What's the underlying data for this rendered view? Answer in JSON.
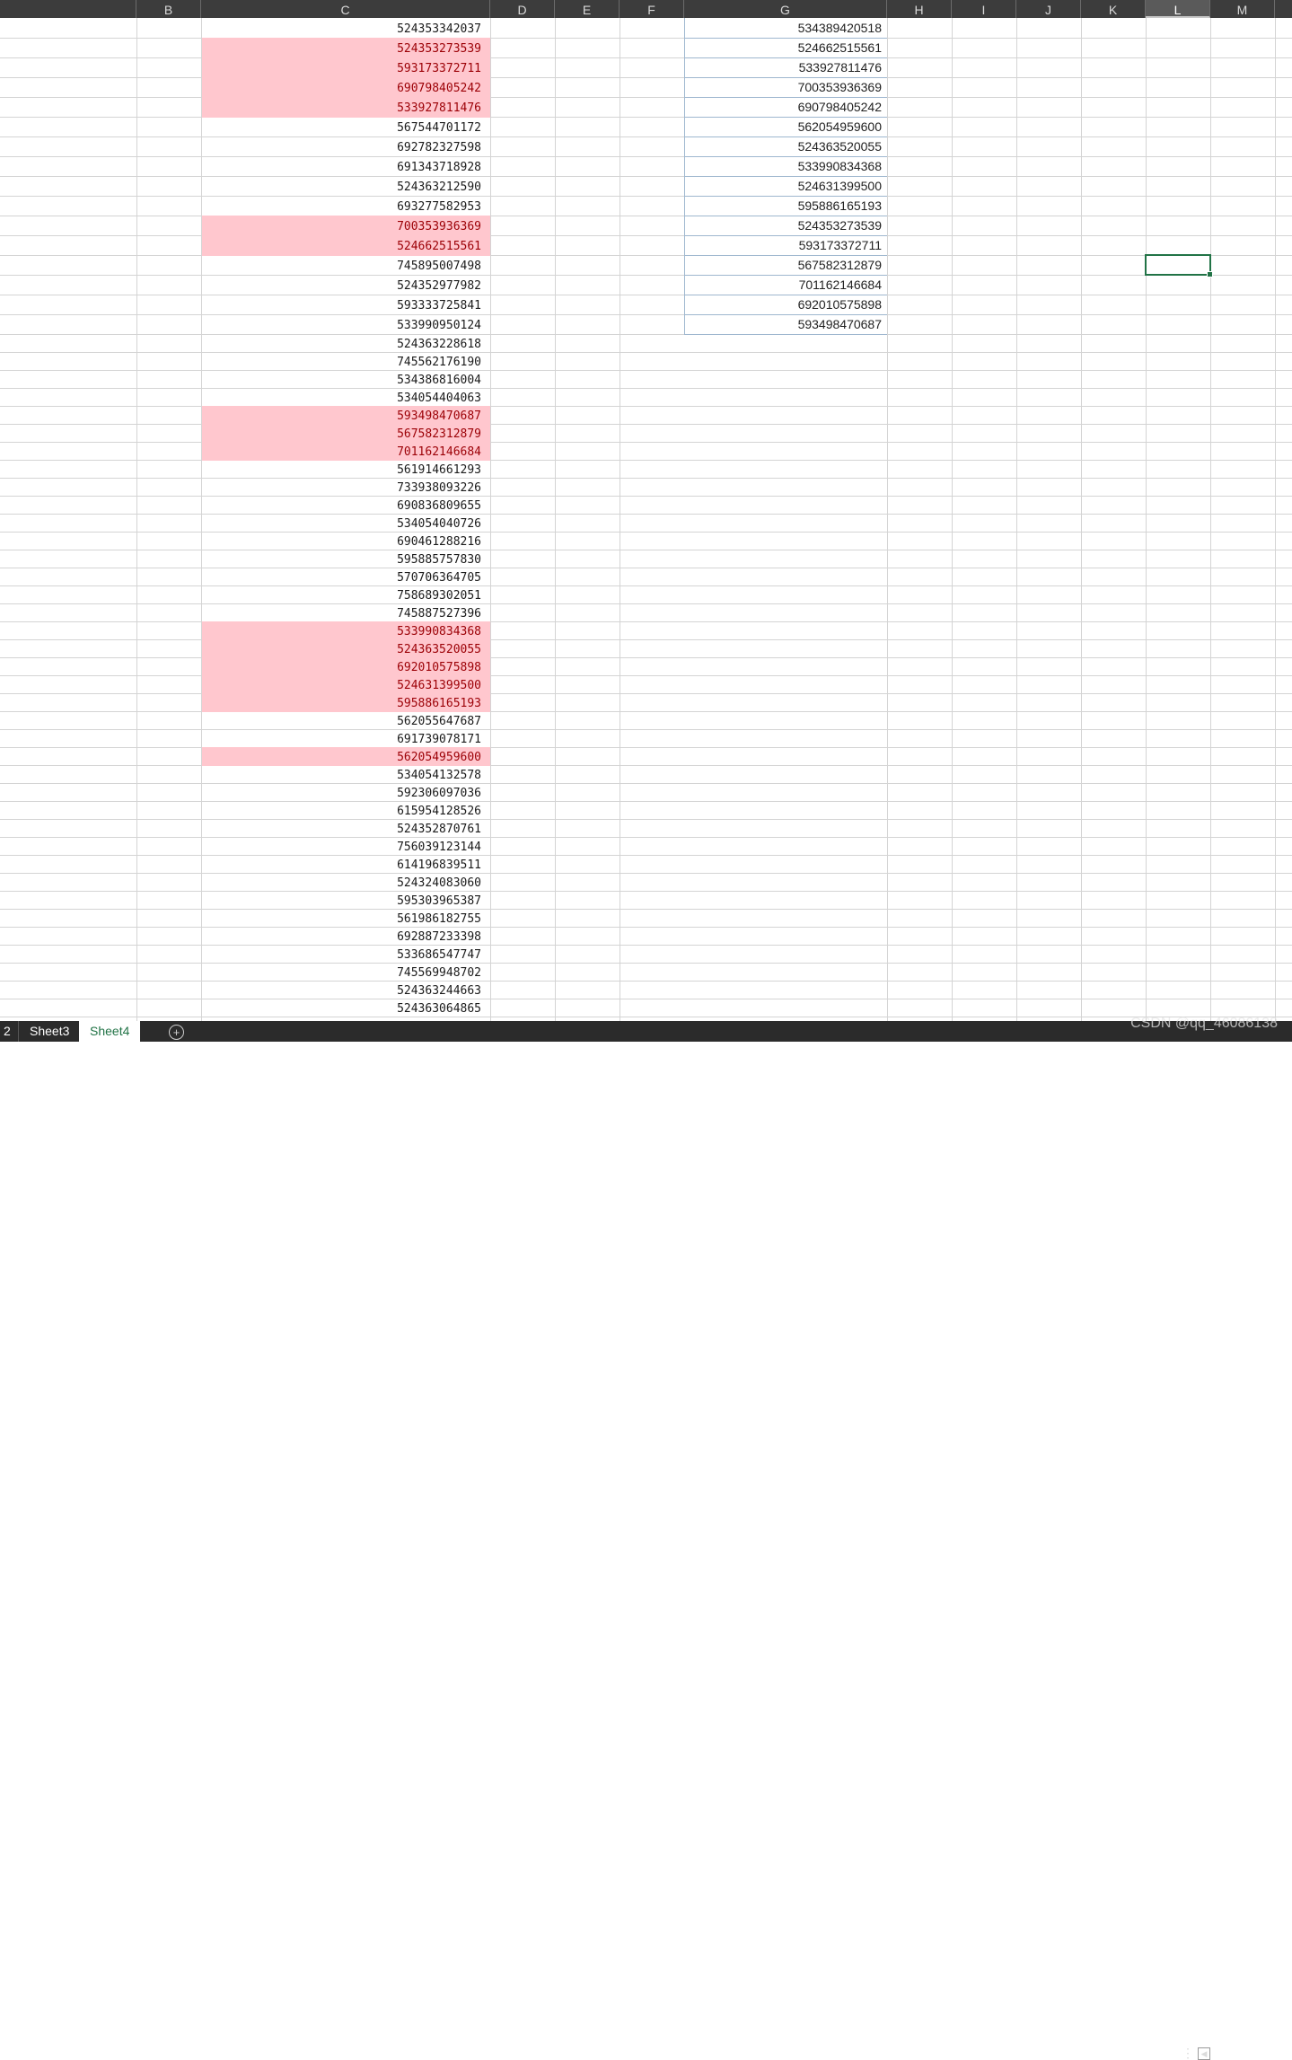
{
  "columns": [
    "B",
    "C",
    "D",
    "E",
    "F",
    "G",
    "H",
    "I",
    "J",
    "K",
    "L",
    "M"
  ],
  "selected_column": "L",
  "column_c_values": [
    "524353342037",
    "524353273539",
    "593173372711",
    "690798405242",
    "533927811476",
    "567544701172",
    "692782327598",
    "691343718928",
    "524363212590",
    "693277582953",
    "700353936369",
    "524662515561",
    "745895007498",
    "524352977982",
    "593333725841",
    "533990950124",
    "524363228618",
    "745562176190",
    "534386816004",
    "534054404063",
    "593498470687",
    "567582312879",
    "701162146684",
    "561914661293",
    "733938093226",
    "690836809655",
    "534054040726",
    "690461288216",
    "595885757830",
    "570706364705",
    "758689302051",
    "745887527396",
    "533990834368",
    "524363520055",
    "692010575898",
    "524631399500",
    "595886165193",
    "562055647687",
    "691739078171",
    "562054959600",
    "534054132578",
    "592306097036",
    "615954128526",
    "524352870761",
    "756039123144",
    "614196839511",
    "524324083060",
    "595303965387",
    "561986182755",
    "692887233398",
    "533686547747",
    "745569948702",
    "524363244663",
    "524363064865"
  ],
  "column_c_highlighted": [
    "524353273539",
    "593173372711",
    "690798405242",
    "533927811476",
    "700353936369",
    "524662515561",
    "593498470687",
    "567582312879",
    "701162146684",
    "533990834368",
    "524363520055",
    "692010575898",
    "524631399500",
    "595886165193",
    "562054959600"
  ],
  "highlight_color": "#ffc7ce",
  "column_g_values": [
    "534389420518",
    "524662515561",
    "533927811476",
    "700353936369",
    "690798405242",
    "562054959600",
    "524363520055",
    "533990834368",
    "524631399500",
    "595886165193",
    "524353273539",
    "593173372711",
    "567582312879",
    "701162146684",
    "692010575898",
    "593498470687"
  ],
  "sheet_tabs": {
    "prev_fragment": "2",
    "tabs": [
      "Sheet3",
      "Sheet4"
    ],
    "active": "Sheet4",
    "add_icon": "plus-circle-icon"
  },
  "watermark": "CSDN @qq_46086138",
  "accent_color": "#217346"
}
